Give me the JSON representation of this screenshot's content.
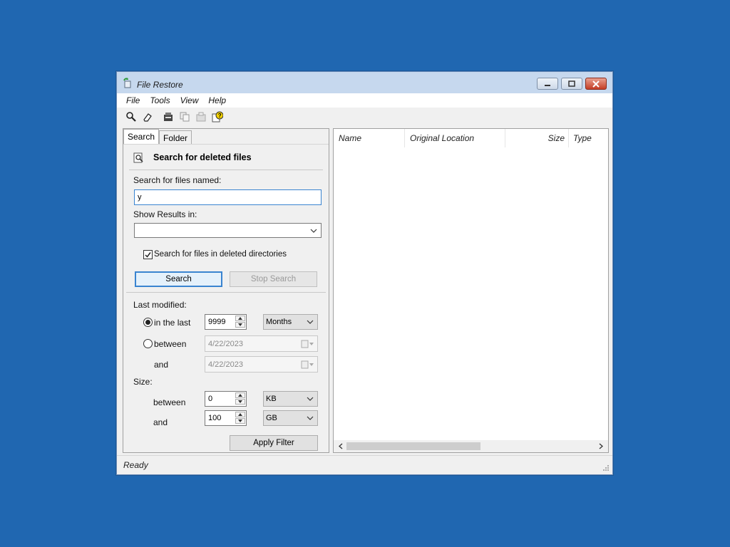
{
  "window": {
    "title": "File Restore"
  },
  "menu": [
    "File",
    "Tools",
    "View",
    "Help"
  ],
  "toolbar": {
    "icons": [
      "magnifier-icon",
      "eraser-icon",
      "restore-icon",
      "copy-icon",
      "properties-icon",
      "help-icon"
    ]
  },
  "tabs": {
    "search": "Search",
    "folder": "Folder"
  },
  "search": {
    "heading": "Search for deleted files",
    "files_named_label": "Search for files named:",
    "files_named_value": "y",
    "show_results_label": "Show Results in:",
    "show_results_value": "",
    "deleted_dirs_label": "Search for files in deleted directories",
    "deleted_dirs_checked": true,
    "search_button": "Search",
    "stop_button": "Stop Search"
  },
  "filter": {
    "last_modified_label": "Last modified:",
    "in_the_last_label": "in the last",
    "in_the_last_value": "9999",
    "in_the_last_unit": "Months",
    "between_label": "between",
    "date_from": "4/22/2023",
    "and_label": "and",
    "date_to": "4/22/2023",
    "size_label": "Size:",
    "size_between_label": "between",
    "size_min": "0",
    "size_min_unit": "KB",
    "size_and_label": "and",
    "size_max": "100",
    "size_max_unit": "GB",
    "apply_button": "Apply Filter"
  },
  "results": {
    "columns": [
      "Name",
      "Original Location",
      "Size",
      "Type"
    ]
  },
  "status": {
    "text": "Ready"
  },
  "colors": {
    "desktop": "#2067b1",
    "titlebar": "#c6d8ee",
    "focus": "#3a84d0"
  }
}
